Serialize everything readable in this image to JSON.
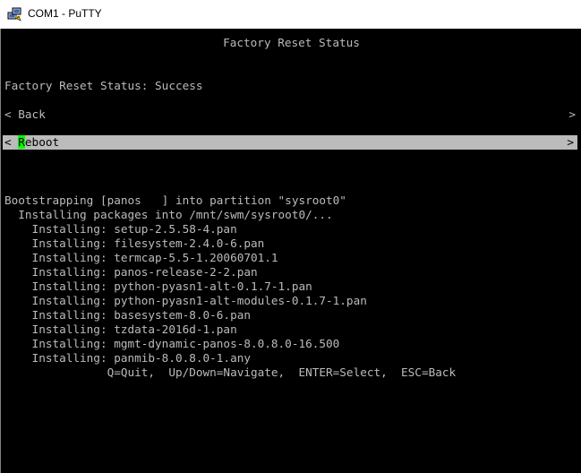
{
  "window": {
    "title": "COM1 - PuTTY",
    "icon": "putty-computers-icon"
  },
  "screen": {
    "header": "Factory Reset Status",
    "status_line": "Factory Reset Status: Success",
    "menu": {
      "back_left": "< Back",
      "back_right": ">",
      "reboot_left": "< ",
      "reboot_hotkey": "R",
      "reboot_rest": "eboot",
      "reboot_right": ">",
      "selected": "Reboot"
    },
    "log": [
      "Bootstrapping [panos   ] into partition \"sysroot0\"",
      "  Installing packages into /mnt/swm/sysroot0/...",
      "    Installing: setup-2.5.58-4.pan",
      "    Installing: filesystem-2.4.0-6.pan",
      "    Installing: termcap-5.5-1.20060701.1",
      "    Installing: panos-release-2-2.pan",
      "    Installing: python-pyasn1-alt-0.1.7-1.pan",
      "    Installing: python-pyasn1-alt-modules-0.1.7-1.pan",
      "    Installing: basesystem-8.0-6.pan",
      "    Installing: tzdata-2016d-1.pan",
      "    Installing: mgmt-dynamic-panos-8.0.8.0-16.500",
      "    Installing: panmib-8.0.8.0-1.any"
    ],
    "help": "               Q=Quit,  Up/Down=Navigate,  ENTER=Select,  ESC=Back"
  },
  "colors": {
    "terminal_bg": "#000000",
    "terminal_fg": "#bbbbbb",
    "selection_bg": "#bbbbbb",
    "cursor": "#00ff00"
  }
}
